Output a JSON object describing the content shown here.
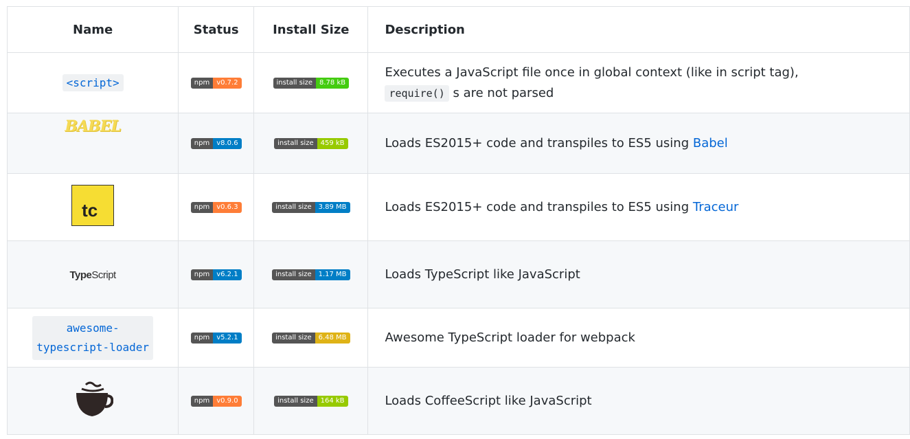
{
  "headers": {
    "name": "Name",
    "status": "Status",
    "install_size": "Install Size",
    "description": "Description"
  },
  "rows": [
    {
      "name": "<script>",
      "name_type": "code",
      "npm_label": "npm",
      "npm_version": "v0.7.2",
      "npm_color": "#fe7d37",
      "size_label": "install size",
      "size_value": "8.78 kB",
      "size_color": "#44cc11",
      "description": "Executes a JavaScript file once in global context (like in script tag),",
      "description_code": "require()",
      "description_after": "s are not parsed"
    },
    {
      "name": "BABEL",
      "name_type": "babel-logo",
      "npm_label": "npm",
      "npm_version": "v8.0.6",
      "npm_color": "#007ec6",
      "size_label": "install size",
      "size_value": "459 kB",
      "size_color": "#97ca00",
      "description": "Loads ES2015+ code and transpiles to ES5 using ",
      "description_link": "Babel"
    },
    {
      "name": "tc",
      "name_type": "traceur-logo",
      "npm_label": "npm",
      "npm_version": "v0.6.3",
      "npm_color": "#fe7d37",
      "size_label": "install size",
      "size_value": "3.89 MB",
      "size_color": "#007ec6",
      "description": "Loads ES2015+ code and transpiles to ES5 using ",
      "description_link": "Traceur"
    },
    {
      "name_bold": "Type",
      "name_rest": "Script",
      "name_type": "typescript-logo",
      "npm_label": "npm",
      "npm_version": "v6.2.1",
      "npm_color": "#007ec6",
      "size_label": "install size",
      "size_value": "1.17 MB",
      "size_color": "#007ec6",
      "description": "Loads TypeScript like JavaScript"
    },
    {
      "name_line1": "awesome-",
      "name_line2": "typescript-loader",
      "name_type": "code",
      "npm_label": "npm",
      "npm_version": "v5.2.1",
      "npm_color": "#007ec6",
      "size_label": "install size",
      "size_value": "6.48 MB",
      "size_color": "#dfb317",
      "description": "Awesome TypeScript loader for webpack"
    },
    {
      "name_type": "coffeescript-logo",
      "npm_label": "npm",
      "npm_version": "v0.9.0",
      "npm_color": "#fe7d37",
      "size_label": "install size",
      "size_value": "164 kB",
      "size_color": "#97ca00",
      "description": "Loads CoffeeScript like JavaScript"
    }
  ]
}
